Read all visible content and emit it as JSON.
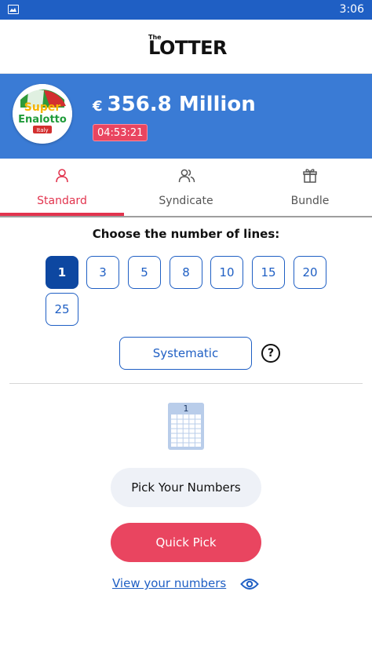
{
  "status_bar": {
    "time": "3:06",
    "left_icon": "image-icon"
  },
  "app_header": {
    "logo_the": "The",
    "logo_text": "LOTTER"
  },
  "lottery": {
    "logo_line1": "Super",
    "logo_line2": "Enalotto",
    "logo_line3": "Italy",
    "currency": "€",
    "jackpot": "356.8 Million",
    "countdown": "04:53:21"
  },
  "tabs": [
    {
      "label": "Standard",
      "icon": "user-icon",
      "active": true
    },
    {
      "label": "Syndicate",
      "icon": "users-icon",
      "active": false
    },
    {
      "label": "Bundle",
      "icon": "gift-icon",
      "active": false
    }
  ],
  "lines": {
    "title": "Choose the number of lines:",
    "options": [
      "1",
      "3",
      "5",
      "8",
      "10",
      "15",
      "20",
      "25"
    ],
    "selected": "1"
  },
  "systematic_label": "Systematic",
  "help_label": "?",
  "ticket_number": "1",
  "pick_numbers_label": "Pick Your Numbers",
  "quick_pick_label": "Quick Pick",
  "view_numbers_label": "View your numbers",
  "colors": {
    "brand_blue": "#1f5fc4",
    "hero_blue": "#3a7bd5",
    "accent_red": "#e94560",
    "selected_blue": "#0d47a1"
  }
}
